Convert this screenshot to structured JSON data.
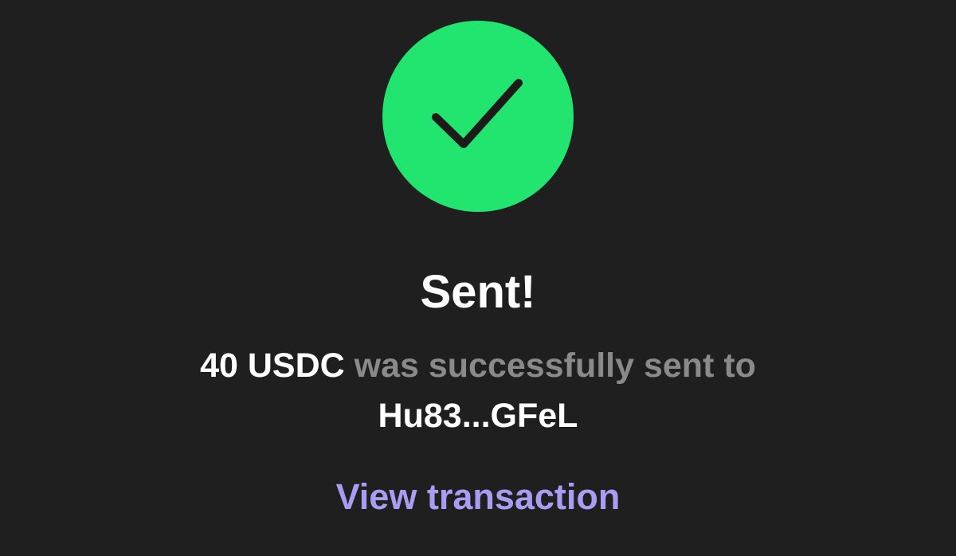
{
  "status": {
    "icon": "check-icon",
    "icon_color": "#21e56f",
    "title": "Sent!"
  },
  "message": {
    "amount": "40 USDC",
    "text": "was successfully sent to",
    "recipient": "Hu83...GFeL"
  },
  "actions": {
    "view_transaction_label": "View transaction"
  },
  "colors": {
    "background": "#1f1f1f",
    "success": "#21e56f",
    "muted_text": "#8a8a8a",
    "link": "#a99cf3"
  }
}
